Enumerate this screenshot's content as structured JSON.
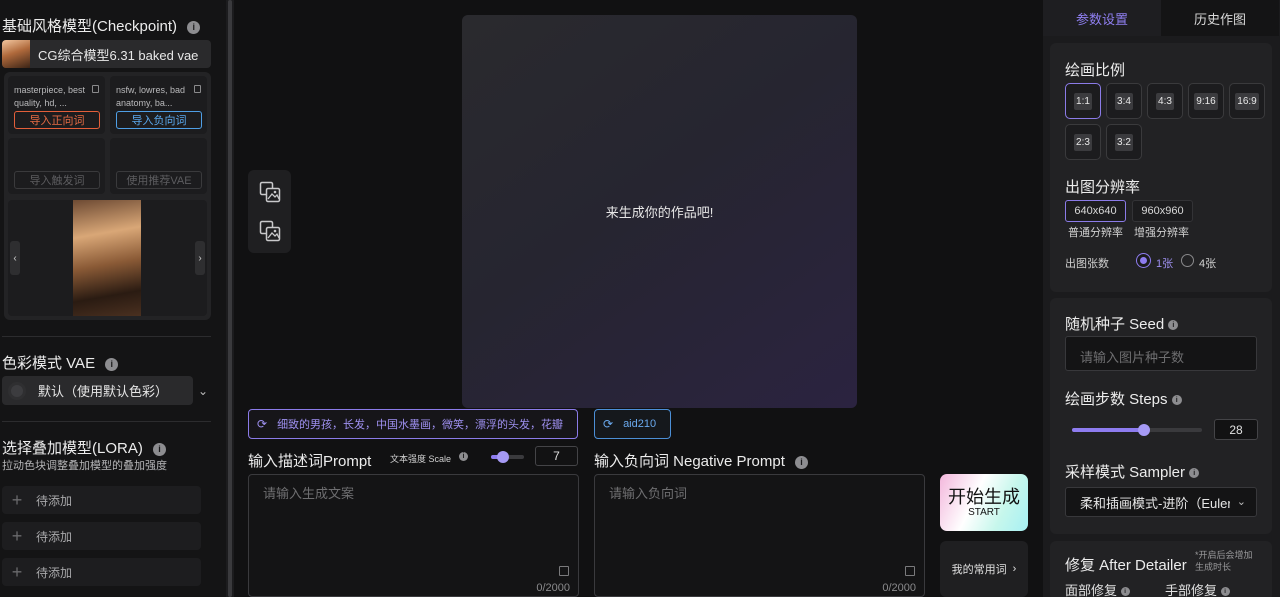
{
  "checkpoint": {
    "title": "基础风格模型(Checkpoint)",
    "selected": "CG综合模型6.31 baked vae",
    "positive_preview": "masterpiece, best quality, hd, ...",
    "negative_preview": "nsfw, lowres, bad anatomy, ba...",
    "import_positive": "导入正向词",
    "import_negative": "导入负向词",
    "import_trigger": "导入触发词",
    "use_recommended_vae": "使用推荐VAE"
  },
  "vae": {
    "title": "色彩模式 VAE",
    "selected": "默认（使用默认色彩）"
  },
  "lora": {
    "title": "选择叠加模型(LORA)",
    "subtitle": "拉动色块调整叠加模型的叠加强度",
    "items": [
      "待添加",
      "待添加",
      "待添加"
    ]
  },
  "canvas": {
    "placeholder": "来生成你的作品吧!"
  },
  "prompt": {
    "suggestion": "细致的男孩，长发，中国水墨画，微笑，漂浮的头发，花瓣",
    "title": "输入描述词Prompt",
    "scale_label": "文本强度 Scale",
    "scale_value": "7",
    "scale_fraction": 0.35,
    "placeholder": "请输入生成文案",
    "count": "0/2000"
  },
  "negative": {
    "suggestion": "aid210",
    "title": "输入负向词 Negative Prompt",
    "placeholder": "请输入负向词",
    "count": "0/2000"
  },
  "actions": {
    "start_main": "开始生成",
    "start_sub": "START",
    "favorites": "我的常用词"
  },
  "tabs": {
    "params": "参数设置",
    "history": "历史作图"
  },
  "ratio": {
    "title": "绘画比例",
    "options": [
      "1:1",
      "3:4",
      "4:3",
      "9:16",
      "16:9",
      "2:3",
      "3:2"
    ],
    "selected": "1:1"
  },
  "resolution": {
    "title": "出图分辨率",
    "options": [
      {
        "value": "640x640",
        "label": "普通分辨率"
      },
      {
        "value": "960x960",
        "label": "增强分辨率"
      }
    ],
    "count_label": "出图张数",
    "count_options": [
      "1张",
      "4张"
    ]
  },
  "seed": {
    "title": "随机种子 Seed",
    "placeholder": "请输入图片种子数"
  },
  "steps": {
    "title": "绘画步数 Steps",
    "value": "28",
    "fraction": 0.55
  },
  "sampler": {
    "title": "采样模式 Sampler",
    "selected": "柔和插画模式-进阶（Euler..."
  },
  "after_detailer": {
    "title": "修复 After Detailer",
    "note": "*开启后会增加生成时长",
    "face": "面部修复",
    "hand": "手部修复"
  },
  "colors": {
    "accent": "#8e7cf0",
    "positive": "#e66b44",
    "negative": "#5aa9ee"
  }
}
